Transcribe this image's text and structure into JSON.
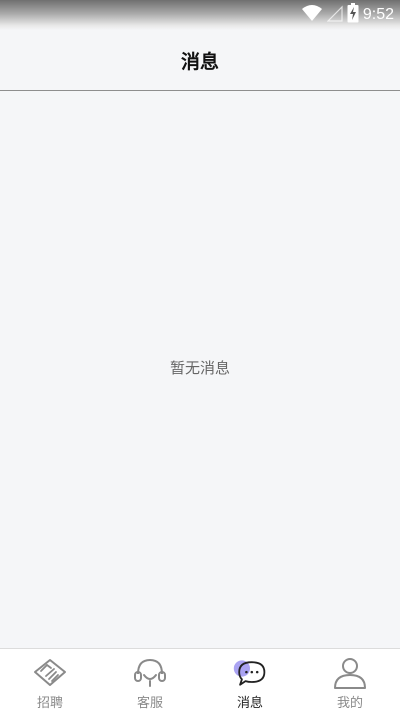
{
  "status_bar": {
    "time": "9:52",
    "icons": [
      "wifi-icon",
      "signal-icon",
      "battery-charging-icon"
    ]
  },
  "header": {
    "title": "消息"
  },
  "main": {
    "empty_message": "暂无消息"
  },
  "tab_bar": {
    "active_index": 2,
    "tabs": [
      {
        "label": "招聘",
        "icon": "handshake-icon"
      },
      {
        "label": "客服",
        "icon": "headset-icon"
      },
      {
        "label": "消息",
        "icon": "chat-bubble-icon"
      },
      {
        "label": "我的",
        "icon": "person-icon"
      }
    ]
  },
  "colors": {
    "background": "#f5f6f8",
    "active_accent": "#9b93f0",
    "inactive_icon": "#8a8a8a",
    "active_icon": "#222222"
  }
}
